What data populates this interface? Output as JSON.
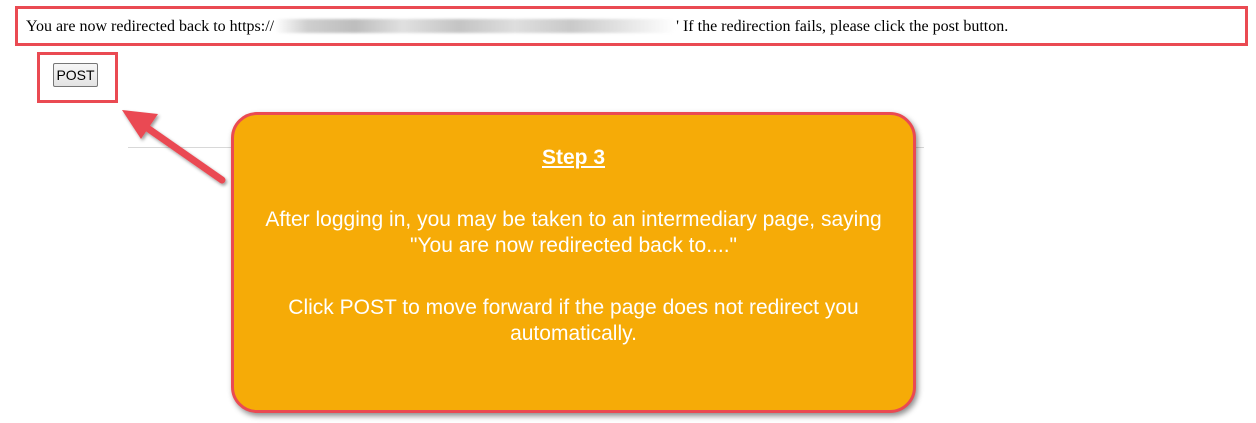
{
  "page": {
    "redirect_prefix": "You are now redirected back to https://",
    "redirect_suffix": "' If the redirection fails, please click the post button.",
    "post_button_label": "POST"
  },
  "callout": {
    "title": "Step 3",
    "paragraph1": "After logging in, you may be taken to an intermediary page, saying \"You are now redirected back to....\"",
    "paragraph2": "Click POST to move forward if the page does not redirect you automatically."
  },
  "colors": {
    "highlight": "#ea4a52",
    "callout_fill": "#f6ab07",
    "callout_text": "#ffffff"
  },
  "icons": {
    "arrow": "arrow-pointing-to-post-button"
  }
}
